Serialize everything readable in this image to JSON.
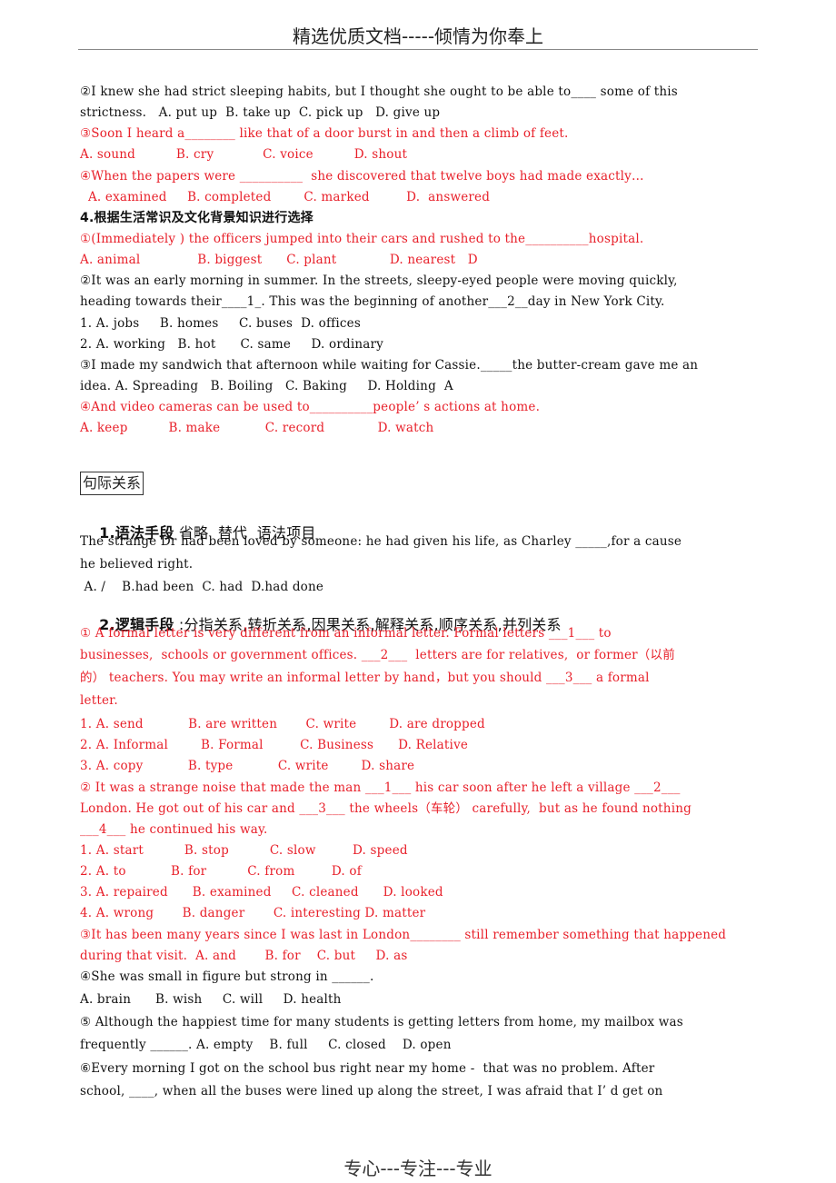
{
  "header": {
    "title": "精选优质文档-----倾情为你奉上"
  },
  "footer": {
    "title": "专心---专注---专业"
  },
  "lines": [
    {
      "text": "②I knew she had strict sleeping habits, but I thought she ought to be able to____ some of this",
      "red": false
    },
    {
      "text": "strictness.   A. put up  B. take up  C. pick up   D. give up",
      "red": false
    },
    {
      "text": "③Soon I heard a________ like that of a door burst in and then a climb of feet.",
      "red": true
    },
    {
      "text": "A. sound          B. cry            C. voice          D. shout",
      "red": true
    },
    {
      "text": "④When the papers were __________  she discovered that twelve boys had made exactly…",
      "red": true
    },
    {
      "text": "  A. examined     B. completed        C. marked         D.  answered",
      "red": true
    },
    {
      "text": "4.根据生活常识及文化背景知识进行选择",
      "red": false,
      "style": "cn-bold"
    },
    {
      "text": "①(Immediately ) the officers jumped into their cars and rushed to the__________hospital.",
      "red": true
    },
    {
      "text": "A. animal              B. biggest      C. plant             D. nearest   D",
      "red": true
    },
    {
      "text": "②It was an early morning in summer. In the streets, sleepy-eyed people were moving quickly,",
      "red": false
    },
    {
      "text": "heading towards their____1_. This was the beginning of another___2__day in New York City.",
      "red": false
    },
    {
      "text": "1. A. jobs     B. homes     C. buses  D. offices",
      "red": false
    },
    {
      "text": "2. A. working   B. hot      C. same     D. ordinary",
      "red": false
    },
    {
      "text": "③I made my sandwich that afternoon while waiting for Cassie._____the butter-cream gave me an",
      "red": false
    },
    {
      "text": "idea. A. Spreading   B. Boiling   C. Baking     D. Holding  A",
      "red": false
    },
    {
      "text": "④And video cameras can be used to__________people’ s actions at home.",
      "red": true
    },
    {
      "text": "A. keep          B. make           C. record             D. watch",
      "red": true
    }
  ],
  "section_box": {
    "label": "句际关系"
  },
  "grammar": {
    "heading_bold": "1.语法手段",
    "heading_rest": " 省略  替代  语法项目",
    "lines": [
      "The strange Dr had been loved by someone: he had given his life, as Charley _____,for a cause",
      "he believed right.",
      " A. /    B.had been  C. had  D.had done"
    ]
  },
  "logic": {
    "heading_bold": "2.逻辑手段",
    "heading_rest": " :分指关系,转折关系,因果关系,解释关系,顺序关系,并列关系",
    "lines": [
      {
        "text": "① A formal letter is very different from an informal letter. Formal letters ___1___ to",
        "red": true
      },
      {
        "text": "businesses,  schools or government offices. ___2___  letters are for relatives,  or former（以前",
        "red": true
      },
      {
        "text": "的） teachers. You may write an informal letter by hand，but you should ___3___ a formal",
        "red": true
      },
      {
        "text": "letter.",
        "red": true
      },
      {
        "text": "1. A. send           B. are written       C. write        D. are dropped",
        "red": true
      },
      {
        "text": "2. A. Informal        B. Formal         C. Business      D. Relative",
        "red": true
      },
      {
        "text": "3. A. copy           B. type           C. write        D. share",
        "red": true
      },
      {
        "text": "② It was a strange noise that made the man ___1___ his car soon after he left a village ___2___",
        "red": true
      },
      {
        "text": "London. He got out of his car and ___3___ the wheels（车轮） carefully,  but as he found nothing",
        "red": true
      },
      {
        "text": "___4___ he continued his way.",
        "red": true
      },
      {
        "text": "1. A. start          B. stop          C. slow         D. speed",
        "red": true
      },
      {
        "text": "2. A. to           B. for          C. from         D. of",
        "red": true
      },
      {
        "text": "3. A. repaired      B. examined     C. cleaned      D. looked",
        "red": true
      },
      {
        "text": "4. A. wrong       B. danger       C. interesting D. matter",
        "red": true
      },
      {
        "text": "③It has been many years since I was last in London________ still remember something that happened",
        "red": true
      },
      {
        "text": "during that visit.  A. and       B. for    C. but     D. as",
        "red": true
      },
      {
        "text": "④She was small in figure but strong in ______.",
        "red": false
      },
      {
        "text": "A. brain      B. wish     C. will     D. health",
        "red": false
      },
      {
        "text": "⑤ Although the happiest time for many students is getting letters from home, my mailbox was",
        "red": false
      },
      {
        "text": "frequently ______. A. empty    B. full     C. closed    D. open",
        "red": false
      },
      {
        "text": "⑥Every morning I got on the school bus right near my home -  that was no problem. After",
        "red": false
      },
      {
        "text": "school, ____, when all the buses were lined up along the street, I was afraid that I’ d get on",
        "red": false
      }
    ]
  },
  "colors": {
    "answer_red": "#e8202a",
    "text": "#111111"
  }
}
